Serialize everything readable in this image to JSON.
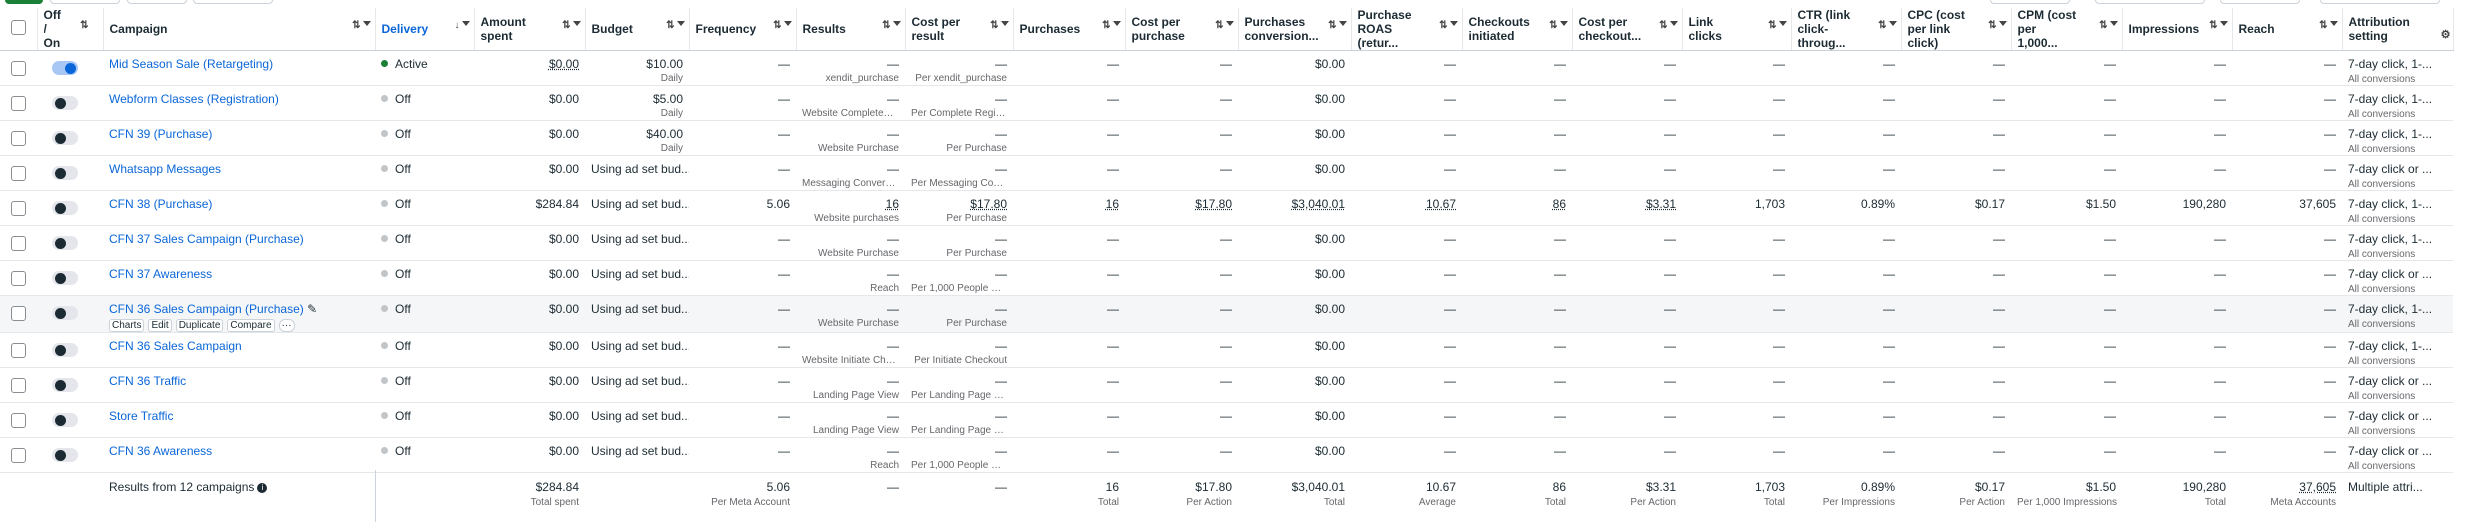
{
  "columns": [
    {
      "key": "select",
      "label": ""
    },
    {
      "key": "toggle",
      "label": "Off / On",
      "sort": "⇅"
    },
    {
      "key": "campaign",
      "label": "Campaign",
      "sort": "⇅"
    },
    {
      "key": "delivery",
      "label": "Delivery",
      "sort": "↓"
    },
    {
      "key": "amount_spent",
      "label": "Amount spent",
      "sort": "⇅"
    },
    {
      "key": "budget",
      "label": "Budget",
      "sort": "⇅"
    },
    {
      "key": "frequency",
      "label": "Frequency",
      "sort": "⇅"
    },
    {
      "key": "results",
      "label": "Results",
      "sort": "⇅"
    },
    {
      "key": "cost_per_result",
      "label": "Cost per result",
      "sort": "⇅"
    },
    {
      "key": "purchases",
      "label": "Purchases",
      "sort": "⇅"
    },
    {
      "key": "cost_per_purchase",
      "label": "Cost per purchase",
      "sort": "⇅"
    },
    {
      "key": "purchases_conversion",
      "label": "Purchases conversion...",
      "sort": "⇅"
    },
    {
      "key": "purchase_roas",
      "label": "Purchase ROAS (retur...",
      "sort": "⇅"
    },
    {
      "key": "checkouts",
      "label": "Checkouts initiated",
      "sort": "⇅"
    },
    {
      "key": "cost_per_checkout",
      "label": "Cost per checkout...",
      "sort": "⇅"
    },
    {
      "key": "link_clicks",
      "label": "Link clicks",
      "sort": "⇅"
    },
    {
      "key": "ctr",
      "label": "CTR (link click-throug...",
      "sort": "⇅"
    },
    {
      "key": "cpc",
      "label": "CPC (cost per link click)",
      "sort": "⇅"
    },
    {
      "key": "cpm",
      "label": "CPM (cost per 1,000...",
      "sort": "⇅"
    },
    {
      "key": "impressions",
      "label": "Impressions",
      "sort": "⇅"
    },
    {
      "key": "reach",
      "label": "Reach",
      "sort": "⇅"
    },
    {
      "key": "attribution",
      "label": "Attribution setting",
      "sort": ""
    }
  ],
  "rows": [
    {
      "on": true,
      "name": "Mid Season Sale (Retargeting)",
      "delivery": "Active",
      "delivery_active": true,
      "amount": "$0.00",
      "amount_u": true,
      "budget": "$10.00",
      "budget_sub": "Daily",
      "frequency": "—",
      "results": "—",
      "results_sub": "xendit_purchase",
      "cpr": "—",
      "cpr_sub": "Per xendit_purchase",
      "purchases": "—",
      "cpp": "—",
      "conv": "$0.00",
      "roas": "—",
      "checkouts": "—",
      "cpc_out": "—",
      "link_clicks": "—",
      "ctr": "—",
      "cpc": "—",
      "cpm": "—",
      "impressions": "—",
      "reach": "—",
      "attribution": "7-day click, 1-...",
      "attribution_sub": "All conversions"
    },
    {
      "on": false,
      "name": "Webform Classes (Registration)",
      "delivery": "Off",
      "delivery_active": false,
      "amount": "$0.00",
      "amount_u": false,
      "budget": "$5.00",
      "budget_sub": "Daily",
      "frequency": "—",
      "results": "—",
      "results_sub": "Website Completed R...",
      "cpr": "—",
      "cpr_sub": "Per Complete Registr...",
      "purchases": "—",
      "cpp": "—",
      "conv": "$0.00",
      "roas": "—",
      "checkouts": "—",
      "cpc_out": "—",
      "link_clicks": "—",
      "ctr": "—",
      "cpc": "—",
      "cpm": "—",
      "impressions": "—",
      "reach": "—",
      "attribution": "7-day click, 1-...",
      "attribution_sub": "All conversions"
    },
    {
      "on": false,
      "name": "CFN 39 (Purchase)",
      "delivery": "Off",
      "delivery_active": false,
      "amount": "$0.00",
      "amount_u": false,
      "budget": "$40.00",
      "budget_sub": "Daily",
      "frequency": "—",
      "results": "—",
      "results_sub": "Website Purchase",
      "cpr": "—",
      "cpr_sub": "Per Purchase",
      "purchases": "—",
      "cpp": "—",
      "conv": "$0.00",
      "roas": "—",
      "checkouts": "—",
      "cpc_out": "—",
      "link_clicks": "—",
      "ctr": "—",
      "cpc": "—",
      "cpm": "—",
      "impressions": "—",
      "reach": "—",
      "attribution": "7-day click, 1-...",
      "attribution_sub": "All conversions"
    },
    {
      "on": false,
      "name": "Whatsapp Messages",
      "delivery": "Off",
      "delivery_active": false,
      "amount": "$0.00",
      "amount_u": false,
      "budget": "Using ad set bud...",
      "budget_sub": "",
      "frequency": "—",
      "results": "—",
      "results_sub": "Messaging Conversat...",
      "cpr": "—",
      "cpr_sub": "Per Messaging Conver...",
      "purchases": "—",
      "cpp": "—",
      "conv": "$0.00",
      "roas": "—",
      "checkouts": "—",
      "cpc_out": "—",
      "link_clicks": "—",
      "ctr": "—",
      "cpc": "—",
      "cpm": "—",
      "impressions": "—",
      "reach": "—",
      "attribution": "7-day click or ...",
      "attribution_sub": "All conversions"
    },
    {
      "on": false,
      "name": "CFN 38 (Purchase)",
      "delivery": "Off",
      "delivery_active": false,
      "amount": "$284.84",
      "amount_u": false,
      "budget": "Using ad set bud...",
      "budget_sub": "",
      "frequency": "5.06",
      "results": "16",
      "results_u": true,
      "results_sub": "Website purchases",
      "cpr": "$17.80",
      "cpr_u": true,
      "cpr_sub": "Per Purchase",
      "purchases": "16",
      "purchases_u": true,
      "cpp": "$17.80",
      "cpp_u": true,
      "conv": "$3,040.01",
      "conv_u": true,
      "roas": "10.67",
      "roas_u": true,
      "checkouts": "86",
      "checkouts_u": true,
      "cpc_out": "$3.31",
      "cpc_out_u": true,
      "link_clicks": "1,703",
      "ctr": "0.89%",
      "cpc": "$0.17",
      "cpm": "$1.50",
      "impressions": "190,280",
      "reach": "37,605",
      "attribution": "7-day click, 1-...",
      "attribution_sub": "All conversions"
    },
    {
      "on": false,
      "name": "CFN 37 Sales Campaign (Purchase)",
      "delivery": "Off",
      "delivery_active": false,
      "amount": "$0.00",
      "amount_u": false,
      "budget": "Using ad set bud...",
      "budget_sub": "",
      "frequency": "—",
      "results": "—",
      "results_sub": "Website Purchase",
      "cpr": "—",
      "cpr_sub": "Per Purchase",
      "purchases": "—",
      "cpp": "—",
      "conv": "$0.00",
      "roas": "—",
      "checkouts": "—",
      "cpc_out": "—",
      "link_clicks": "—",
      "ctr": "—",
      "cpc": "—",
      "cpm": "—",
      "impressions": "—",
      "reach": "—",
      "attribution": "7-day click, 1-...",
      "attribution_sub": "All conversions"
    },
    {
      "on": false,
      "name": "CFN 37 Awareness",
      "delivery": "Off",
      "delivery_active": false,
      "amount": "$0.00",
      "amount_u": false,
      "budget": "Using ad set bud...",
      "budget_sub": "",
      "frequency": "—",
      "results": "—",
      "results_sub": "Reach",
      "cpr": "—",
      "cpr_sub": "Per 1,000 People Reac...",
      "purchases": "—",
      "cpp": "—",
      "conv": "$0.00",
      "roas": "—",
      "checkouts": "—",
      "cpc_out": "—",
      "link_clicks": "—",
      "ctr": "—",
      "cpc": "—",
      "cpm": "—",
      "impressions": "—",
      "reach": "—",
      "attribution": "7-day click or ...",
      "attribution_sub": "All conversions"
    },
    {
      "on": false,
      "name": "CFN 36 Sales Campaign (Purchase)",
      "hover": true,
      "delivery": "Off",
      "delivery_active": false,
      "amount": "$0.00",
      "amount_u": false,
      "budget": "Using ad set bud...",
      "budget_sub": "",
      "frequency": "—",
      "results": "—",
      "results_sub": "Website Purchase",
      "cpr": "—",
      "cpr_sub": "Per Purchase",
      "purchases": "—",
      "cpp": "—",
      "conv": "$0.00",
      "roas": "—",
      "checkouts": "—",
      "cpc_out": "—",
      "link_clicks": "—",
      "ctr": "—",
      "cpc": "—",
      "cpm": "—",
      "impressions": "—",
      "reach": "—",
      "attribution": "7-day click, 1-...",
      "attribution_sub": "All conversions"
    },
    {
      "on": false,
      "name": "CFN 36 Sales Campaign",
      "delivery": "Off",
      "delivery_active": false,
      "amount": "$0.00",
      "amount_u": false,
      "budget": "Using ad set bud...",
      "budget_sub": "",
      "frequency": "—",
      "results": "—",
      "results_sub": "Website Initiate Check...",
      "cpr": "—",
      "cpr_sub": "Per Initiate Checkout",
      "purchases": "—",
      "cpp": "—",
      "conv": "$0.00",
      "roas": "—",
      "checkouts": "—",
      "cpc_out": "—",
      "link_clicks": "—",
      "ctr": "—",
      "cpc": "—",
      "cpm": "—",
      "impressions": "—",
      "reach": "—",
      "attribution": "7-day click, 1-...",
      "attribution_sub": "All conversions"
    },
    {
      "on": false,
      "name": "CFN 36 Traffic",
      "delivery": "Off",
      "delivery_active": false,
      "amount": "$0.00",
      "amount_u": false,
      "budget": "Using ad set bud...",
      "budget_sub": "",
      "frequency": "—",
      "results": "—",
      "results_sub": "Landing Page View",
      "cpr": "—",
      "cpr_sub": "Per Landing Page View",
      "purchases": "—",
      "cpp": "—",
      "conv": "$0.00",
      "roas": "—",
      "checkouts": "—",
      "cpc_out": "—",
      "link_clicks": "—",
      "ctr": "—",
      "cpc": "—",
      "cpm": "—",
      "impressions": "—",
      "reach": "—",
      "attribution": "7-day click or ...",
      "attribution_sub": "All conversions"
    },
    {
      "on": false,
      "name": "Store Traffic",
      "delivery": "Off",
      "delivery_active": false,
      "amount": "$0.00",
      "amount_u": false,
      "budget": "Using ad set bud...",
      "budget_sub": "",
      "frequency": "—",
      "results": "—",
      "results_sub": "Landing Page View",
      "cpr": "—",
      "cpr_sub": "Per Landing Page View",
      "purchases": "—",
      "cpp": "—",
      "conv": "$0.00",
      "roas": "—",
      "checkouts": "—",
      "cpc_out": "—",
      "link_clicks": "—",
      "ctr": "—",
      "cpc": "—",
      "cpm": "—",
      "impressions": "—",
      "reach": "—",
      "attribution": "7-day click or ...",
      "attribution_sub": "All conversions"
    },
    {
      "on": false,
      "name": "CFN 36 Awareness",
      "delivery": "Off",
      "delivery_active": false,
      "amount": "$0.00",
      "amount_u": false,
      "budget": "Using ad set bud...",
      "budget_sub": "",
      "frequency": "—",
      "results": "—",
      "results_sub": "Reach",
      "cpr": "—",
      "cpr_sub": "Per 1,000 People Reac...",
      "purchases": "—",
      "cpp": "—",
      "conv": "$0.00",
      "roas": "—",
      "checkouts": "—",
      "cpc_out": "—",
      "link_clicks": "—",
      "ctr": "—",
      "cpc": "—",
      "cpm": "—",
      "impressions": "—",
      "reach": "—",
      "attribution": "7-day click or ...",
      "attribution_sub": "All conversions"
    }
  ],
  "row_actions": {
    "charts": "Charts",
    "edit": "Edit",
    "duplicate": "Duplicate",
    "compare": "Compare",
    "more": "···"
  },
  "totals": {
    "label": "Results from 12 campaigns",
    "amount": "$284.84",
    "amount_sub": "Total spent",
    "frequency": "5.06",
    "frequency_sub": "Per Meta Account",
    "results": "—",
    "cpr": "—",
    "purchases": "16",
    "purchases_sub": "Total",
    "cpp": "$17.80",
    "cpp_sub": "Per Action",
    "conv": "$3,040.01",
    "conv_sub": "Total",
    "roas": "10.67",
    "roas_sub": "Average",
    "checkouts": "86",
    "checkouts_sub": "Total",
    "cpc_out": "$3.31",
    "cpc_out_sub": "Per Action",
    "link_clicks": "1,703",
    "link_clicks_sub": "Total",
    "ctr": "0.89%",
    "ctr_sub": "Per Impressions",
    "cpc": "$0.17",
    "cpc_sub": "Per Action",
    "cpm": "$1.50",
    "cpm_sub": "Per 1,000 Impressions",
    "impressions": "190,280",
    "impressions_sub": "Total",
    "reach": "37,605",
    "reach_sub": "Meta Accounts",
    "attribution": "Multiple attri..."
  },
  "icons": {
    "settings": "⚙",
    "pencil": "✎",
    "info": "i"
  },
  "colors": {
    "link": "#0a66d8",
    "active": "#1a7f37",
    "toggle_on": "#0a66d8"
  }
}
